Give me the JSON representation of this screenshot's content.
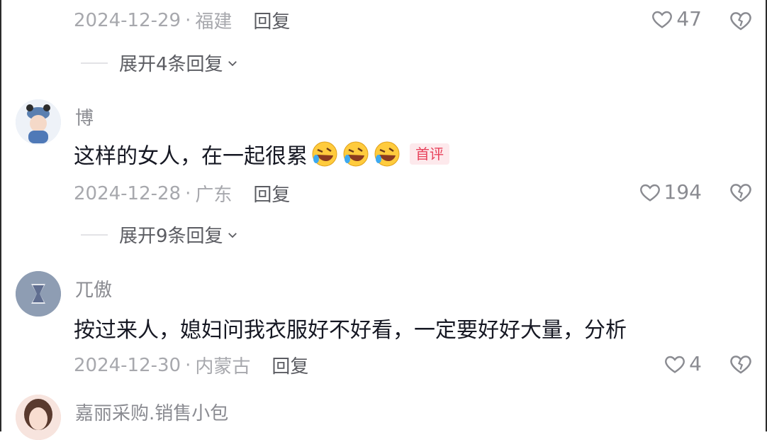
{
  "comments": [
    {
      "date": "2024-12-29",
      "location": "福建",
      "reply_label": "回复",
      "likes": "47",
      "expand_label": "展开4条回复"
    },
    {
      "username": "博",
      "content": "这样的女人，在一起很累",
      "badge": "首评",
      "date": "2024-12-28",
      "location": "广东",
      "reply_label": "回复",
      "likes": "194",
      "expand_label": "展开9条回复"
    },
    {
      "username": "兀傲",
      "content": "按过来人，媳妇问我衣服好不好看，一定要好好大量，分析",
      "date": "2024-12-30",
      "location": "内蒙古",
      "reply_label": "回复",
      "likes": "4"
    },
    {
      "username": "嘉丽采购.销售小包"
    }
  ],
  "meta_separator": "·",
  "icons": {
    "like": "heart-outline-icon",
    "dislike": "broken-heart-icon",
    "expand": "chevron-down-icon",
    "emoji": "rofl-emoji-icon"
  },
  "colors": {
    "text_primary": "#161823",
    "text_secondary": "#8a8b91",
    "badge_red": "#e8425b"
  }
}
